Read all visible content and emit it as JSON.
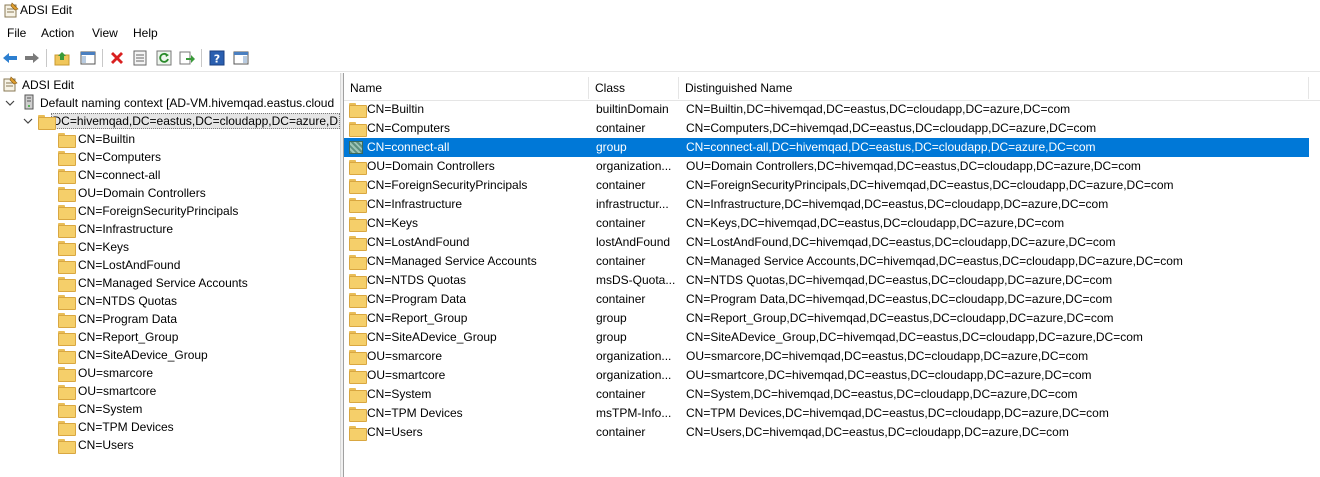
{
  "window": {
    "title": "ADSI Edit"
  },
  "menu": [
    "File",
    "Action",
    "View",
    "Help"
  ],
  "toolbar": {
    "icons": [
      "back-arrow-icon",
      "forward-arrow-icon",
      "up-folder-icon",
      "show-hide-tree-icon",
      "delete-icon",
      "properties-icon",
      "refresh-icon",
      "export-list-icon",
      "help-icon",
      "show-hide-action-pane-icon"
    ]
  },
  "tree": {
    "root": "ADSI Edit",
    "context": "Default naming context [AD-VM.hivemqad.eastus.cloud",
    "domain": "DC=hivemqad,DC=eastus,DC=cloudapp,DC=azure,D",
    "children": [
      "CN=Builtin",
      "CN=Computers",
      "CN=connect-all",
      "OU=Domain Controllers",
      "CN=ForeignSecurityPrincipals",
      "CN=Infrastructure",
      "CN=Keys",
      "CN=LostAndFound",
      "CN=Managed Service Accounts",
      "CN=NTDS Quotas",
      "CN=Program Data",
      "CN=Report_Group",
      "CN=SiteADevice_Group",
      "OU=smarcore",
      "OU=smartcore",
      "CN=System",
      "CN=TPM Devices",
      "CN=Users"
    ]
  },
  "list": {
    "columns": [
      "Name",
      "Class",
      "Distinguished Name"
    ],
    "rows": [
      {
        "name": "CN=Builtin",
        "class": "builtinDomain",
        "dn": "CN=Builtin,DC=hivemqad,DC=eastus,DC=cloudapp,DC=azure,DC=com",
        "icon": "folder-icon"
      },
      {
        "name": "CN=Computers",
        "class": "container",
        "dn": "CN=Computers,DC=hivemqad,DC=eastus,DC=cloudapp,DC=azure,DC=com",
        "icon": "folder-icon"
      },
      {
        "name": "CN=connect-all",
        "class": "group",
        "dn": "CN=connect-all,DC=hivemqad,DC=eastus,DC=cloudapp,DC=azure,DC=com",
        "icon": "group-icon",
        "selected": true
      },
      {
        "name": "OU=Domain Controllers",
        "class": "organization...",
        "dn": "OU=Domain Controllers,DC=hivemqad,DC=eastus,DC=cloudapp,DC=azure,DC=com",
        "icon": "folder-icon"
      },
      {
        "name": "CN=ForeignSecurityPrincipals",
        "class": "container",
        "dn": "CN=ForeignSecurityPrincipals,DC=hivemqad,DC=eastus,DC=cloudapp,DC=azure,DC=com",
        "icon": "folder-icon"
      },
      {
        "name": "CN=Infrastructure",
        "class": "infrastructur...",
        "dn": "CN=Infrastructure,DC=hivemqad,DC=eastus,DC=cloudapp,DC=azure,DC=com",
        "icon": "folder-icon"
      },
      {
        "name": "CN=Keys",
        "class": "container",
        "dn": "CN=Keys,DC=hivemqad,DC=eastus,DC=cloudapp,DC=azure,DC=com",
        "icon": "folder-icon"
      },
      {
        "name": "CN=LostAndFound",
        "class": "lostAndFound",
        "dn": "CN=LostAndFound,DC=hivemqad,DC=eastus,DC=cloudapp,DC=azure,DC=com",
        "icon": "folder-icon"
      },
      {
        "name": "CN=Managed Service Accounts",
        "class": "container",
        "dn": "CN=Managed Service Accounts,DC=hivemqad,DC=eastus,DC=cloudapp,DC=azure,DC=com",
        "icon": "folder-icon"
      },
      {
        "name": "CN=NTDS Quotas",
        "class": "msDS-Quota...",
        "dn": "CN=NTDS Quotas,DC=hivemqad,DC=eastus,DC=cloudapp,DC=azure,DC=com",
        "icon": "folder-icon"
      },
      {
        "name": "CN=Program Data",
        "class": "container",
        "dn": "CN=Program Data,DC=hivemqad,DC=eastus,DC=cloudapp,DC=azure,DC=com",
        "icon": "folder-icon"
      },
      {
        "name": "CN=Report_Group",
        "class": "group",
        "dn": "CN=Report_Group,DC=hivemqad,DC=eastus,DC=cloudapp,DC=azure,DC=com",
        "icon": "folder-icon"
      },
      {
        "name": "CN=SiteADevice_Group",
        "class": "group",
        "dn": "CN=SiteADevice_Group,DC=hivemqad,DC=eastus,DC=cloudapp,DC=azure,DC=com",
        "icon": "folder-icon"
      },
      {
        "name": "OU=smarcore",
        "class": "organization...",
        "dn": "OU=smarcore,DC=hivemqad,DC=eastus,DC=cloudapp,DC=azure,DC=com",
        "icon": "folder-icon"
      },
      {
        "name": "OU=smartcore",
        "class": "organization...",
        "dn": "OU=smartcore,DC=hivemqad,DC=eastus,DC=cloudapp,DC=azure,DC=com",
        "icon": "folder-icon"
      },
      {
        "name": "CN=System",
        "class": "container",
        "dn": "CN=System,DC=hivemqad,DC=eastus,DC=cloudapp,DC=azure,DC=com",
        "icon": "folder-icon"
      },
      {
        "name": "CN=TPM Devices",
        "class": "msTPM-Info...",
        "dn": "CN=TPM Devices,DC=hivemqad,DC=eastus,DC=cloudapp,DC=azure,DC=com",
        "icon": "folder-icon"
      },
      {
        "name": "CN=Users",
        "class": "container",
        "dn": "CN=Users,DC=hivemqad,DC=eastus,DC=cloudapp,DC=azure,DC=com",
        "icon": "folder-icon"
      }
    ]
  },
  "colors": {
    "selection": "#0078d7",
    "folder": "#f5cf6a"
  }
}
